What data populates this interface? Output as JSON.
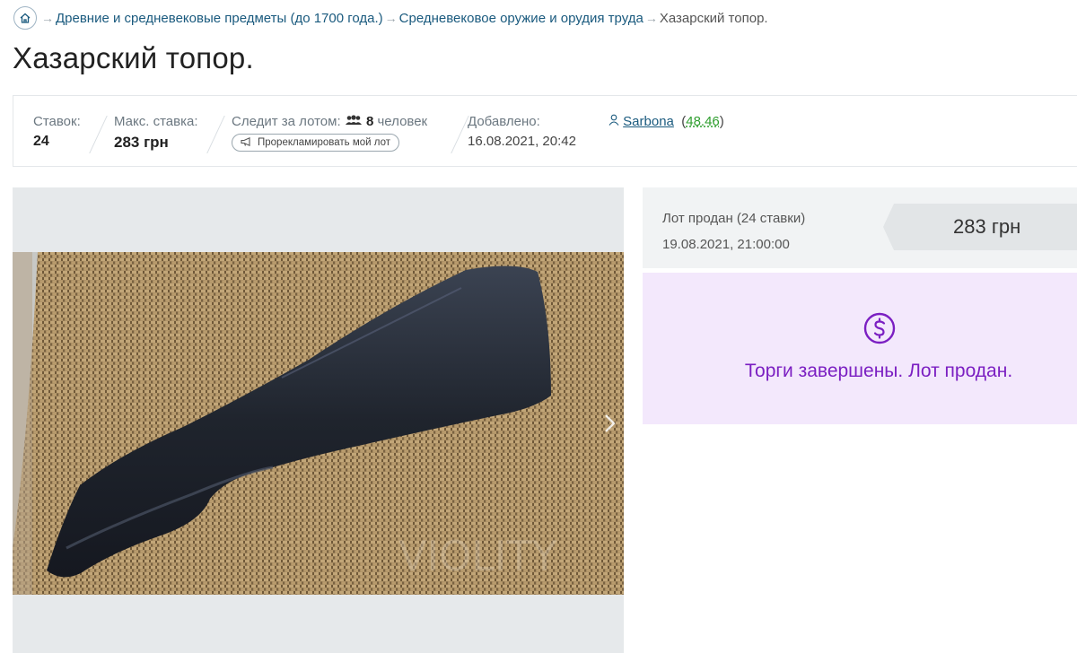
{
  "breadcrumb": {
    "items": [
      "Древние и средневековые предметы (до 1700 года.)",
      "Средневековое оружие и орудия труда"
    ],
    "current": "Хазарский топор."
  },
  "title": "Хазарский топор.",
  "info": {
    "bids_label": "Ставок:",
    "bids_value": "24",
    "max_bid_label": "Макс. ставка:",
    "max_bid_value": "283 грн",
    "watchers_label": "Следит за лотом:",
    "watchers_count": "8",
    "watchers_unit": "человек",
    "promote_label": "Прорекламировать мой лот",
    "added_label": "Добавлено:",
    "added_value": "16.08.2021, 20:42",
    "seller_name": "Sarbona",
    "seller_rating": "48.46"
  },
  "sale": {
    "status_line": "Лот продан (24 ставки)",
    "end_date": "19.08.2021, 21:00:00",
    "price": "283 грн",
    "final_message": "Торги завершены. Лот продан."
  },
  "icons": [
    "home-icon",
    "users-icon",
    "megaphone-icon",
    "user-icon",
    "chevron-right-icon",
    "dollar-circle-icon"
  ],
  "colors": {
    "link": "#1a5a7e",
    "accent": "#7b1fc2",
    "rating": "#2e9e2e",
    "status_bg": "#f3e8fc"
  }
}
